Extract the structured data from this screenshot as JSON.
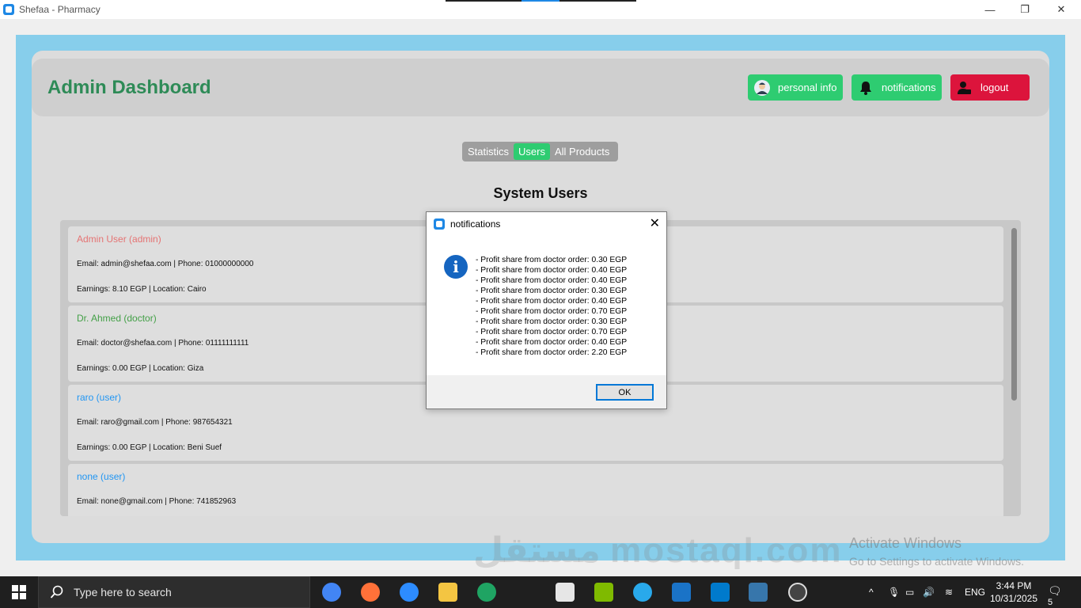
{
  "window": {
    "title": "Shefaa - Pharmacy",
    "minimize": "—",
    "restore": "❐",
    "close": "✕"
  },
  "header": {
    "title": "Admin Dashboard",
    "buttons": {
      "personal_info": "personal info",
      "notifications": "notifications",
      "logout": "logout"
    }
  },
  "tabs": [
    "Statistics",
    "Users",
    "All Products"
  ],
  "section_title": "System Users",
  "users": [
    {
      "name": "Admin User (admin)",
      "line1": "Email: admin@shefaa.com | Phone: 01000000000",
      "line2": "Earnings: 8.10 EGP | Location: Cairo",
      "color": "#e57373"
    },
    {
      "name": "Dr. Ahmed (doctor)",
      "line1": "Email: doctor@shefaa.com | Phone: 01111111111",
      "line2": "Earnings: 0.00 EGP | Location: Giza",
      "color": "#43a047"
    },
    {
      "name": "raro (user)",
      "line1": "Email: raro@gmail.com | Phone: 987654321",
      "line2": "Earnings: 0.00 EGP | Location: Beni Suef",
      "color": "#2196f3"
    },
    {
      "name": "none (user)",
      "line1": "Email: none@gmail.com | Phone: 741852963",
      "line2": "",
      "color": "#2196f3"
    }
  ],
  "dialog": {
    "title": "notifications",
    "close": "✕",
    "lines": [
      "- Profit share from doctor order: 0.30 EGP",
      "- Profit share from doctor order: 0.40 EGP",
      "- Profit share from doctor order: 0.40 EGP",
      "- Profit share from doctor order: 0.30 EGP",
      "- Profit share from doctor order: 0.40 EGP",
      "- Profit share from doctor order: 0.70 EGP",
      "- Profit share from doctor order: 0.30 EGP",
      "- Profit share from doctor order: 0.70 EGP",
      "- Profit share from doctor order: 0.40 EGP",
      "- Profit share from doctor order: 2.20 EGP"
    ],
    "ok": "OK"
  },
  "activation": {
    "line1": "Activate Windows",
    "line2": "Go to Settings to activate Windows."
  },
  "watermark": "مستقل mostaql.com",
  "taskbar": {
    "search_placeholder": "Type here to search",
    "language": "ENG",
    "time": "3:44 PM",
    "date": "10/31/2025",
    "notification_count": "5"
  },
  "colors": {
    "accent_green": "#2ecc71",
    "logout_red": "#dc143c",
    "title_green": "#2e8b57",
    "sky_background": "#87ceeb"
  }
}
